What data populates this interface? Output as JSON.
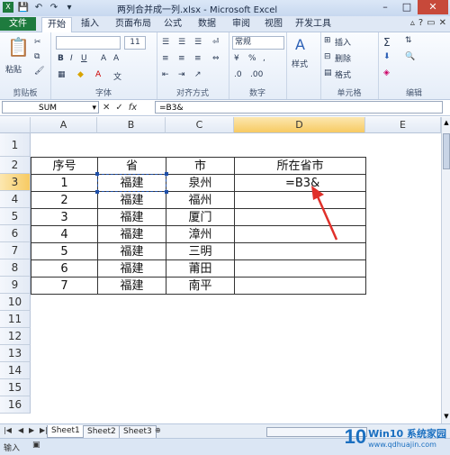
{
  "window": {
    "title": "两列合并成一列.xlsx - Microsoft Excel",
    "min": "–",
    "max": "□",
    "close": "✕"
  },
  "ribbon_tabs": [
    "文件",
    "开始",
    "插入",
    "页面布局",
    "公式",
    "数据",
    "审阅",
    "视图",
    "开发工具"
  ],
  "ribbon": {
    "font_name": "",
    "font_size": "11",
    "number_format": "常规",
    "groups": [
      "剪贴板",
      "字体",
      "对齐方式",
      "数字",
      "单元格",
      "编辑"
    ],
    "paste_label": "粘贴",
    "styles_label": "样式",
    "insert_label": "插入",
    "delete_label": "删除",
    "format_label": "格式"
  },
  "formula_bar": {
    "name_box": "SUM",
    "cancel": "✕",
    "enter": "✓",
    "fx": "fx",
    "formula": "=B3&"
  },
  "columns": [
    "A",
    "B",
    "C",
    "D",
    "E"
  ],
  "rows": [
    "1",
    "2",
    "3",
    "4",
    "5",
    "6",
    "7",
    "8",
    "9",
    "10",
    "11",
    "12",
    "13",
    "14",
    "15",
    "16"
  ],
  "table": {
    "headers": [
      "序号",
      "省",
      "市",
      "所在省市"
    ],
    "data": [
      [
        "1",
        "福建",
        "泉州",
        "=B3&"
      ],
      [
        "2",
        "福建",
        "福州",
        ""
      ],
      [
        "3",
        "福建",
        "厦门",
        ""
      ],
      [
        "4",
        "福建",
        "漳州",
        ""
      ],
      [
        "5",
        "福建",
        "三明",
        ""
      ],
      [
        "6",
        "福建",
        "莆田",
        ""
      ],
      [
        "7",
        "福建",
        "南平",
        ""
      ]
    ]
  },
  "sheets": [
    "Sheet1",
    "Sheet2",
    "Sheet3"
  ],
  "status": {
    "mode": "输入"
  },
  "watermark": {
    "logo": "10",
    "brand": "Win10 系统家园",
    "url": "www.qdhuajin.com"
  },
  "colors": {
    "file_tab": "#1e7b3e",
    "arrow": "#e0302a",
    "selection": "#1f4fa8"
  }
}
